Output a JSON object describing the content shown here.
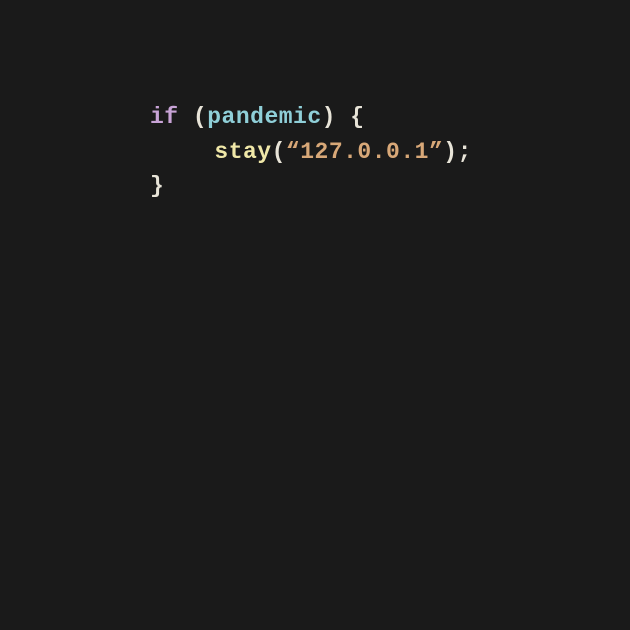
{
  "code": {
    "keyword": "if",
    "condition": "pandemic",
    "function": "stay",
    "string": "“127.0.0.1”",
    "open_paren": "(",
    "close_paren": ")",
    "open_brace": "{",
    "close_brace": "}",
    "semicolon": ";",
    "space": " "
  }
}
